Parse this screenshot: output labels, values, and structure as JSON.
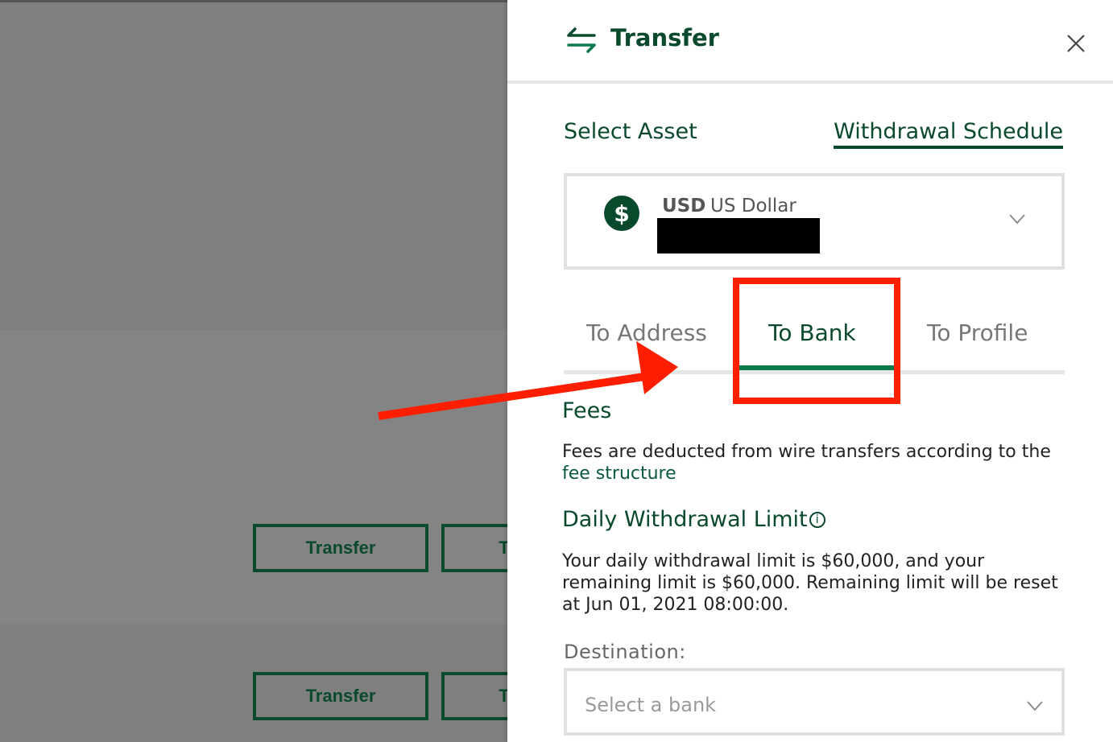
{
  "background": {
    "buttons": [
      "Transfer",
      "T",
      "Transfer",
      "T"
    ]
  },
  "panel": {
    "title": "Transfer",
    "icons": {
      "transfer": "transfer-arrows-icon",
      "close": "close-icon"
    },
    "select_asset_label": "Select Asset",
    "withdrawal_schedule_link": "Withdrawal Schedule",
    "asset": {
      "code": "USD",
      "name": "US Dollar",
      "icon": "dollar-icon",
      "icon_symbol": "$"
    },
    "tabs": [
      {
        "label": "To Address",
        "active": false
      },
      {
        "label": "To Bank",
        "active": true
      },
      {
        "label": "To Profile",
        "active": false
      }
    ],
    "fees": {
      "title": "Fees",
      "text": "Fees are deducted from wire transfers according to the",
      "link": "fee structure"
    },
    "daily_limit": {
      "title": "Daily Withdrawal Limit",
      "info_symbol": "i",
      "text": "Your daily withdrawal limit is $60,000, and your remaining limit is $60,000. Remaining limit will be reset at Jun 01, 2021 08:00:00."
    },
    "destination": {
      "label": "Destination",
      "colon": ":",
      "placeholder": "Select a bank"
    }
  },
  "colors": {
    "brand_green": "#0a4a2c",
    "accent_green": "#0a7a4a",
    "annotation_red": "#ff1f00",
    "backdrop": "#7f7f80"
  }
}
